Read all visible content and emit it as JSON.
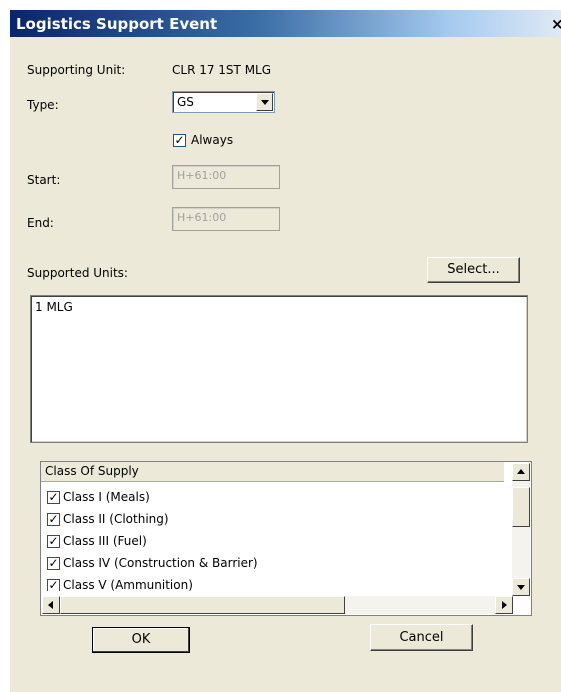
{
  "window": {
    "title": "Logistics Support Event",
    "close_glyph": "×"
  },
  "form": {
    "supporting_unit_label": "Supporting Unit:",
    "supporting_unit_value": "CLR 17 1ST MLG",
    "type_label": "Type:",
    "type_value": "GS",
    "always_label": "Always",
    "always_checked": true,
    "start_label": "Start:",
    "start_value": "H+61:00",
    "end_label": "End:",
    "end_value": "H+61:00",
    "supported_units_label": "Supported Units:",
    "select_button": "Select..."
  },
  "supported_units": [
    "1 MLG"
  ],
  "class_of_supply": {
    "header": "Class Of Supply",
    "items": [
      {
        "label": "Class I (Meals)",
        "checked": true
      },
      {
        "label": "Class II (Clothing)",
        "checked": true
      },
      {
        "label": "Class III (Fuel)",
        "checked": true
      },
      {
        "label": "Class IV (Construction & Barrier)",
        "checked": true
      },
      {
        "label": "Class V (Ammunition)",
        "checked": true
      }
    ]
  },
  "buttons": {
    "ok": "OK",
    "cancel": "Cancel"
  },
  "icons": {
    "checkmark": "✓"
  }
}
